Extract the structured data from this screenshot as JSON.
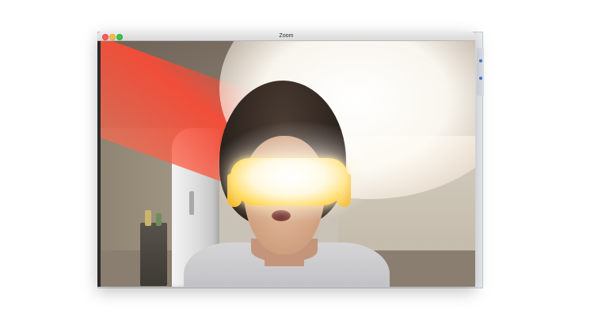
{
  "window": {
    "title": "Zoom"
  },
  "colors": {
    "close": "#fc605c",
    "minimize": "#fdbc40",
    "maximize": "#34c84a",
    "goggle_accent": "#f7b417",
    "red_light": "#f74c37"
  },
  "icons": [
    "close-button",
    "minimize-button",
    "maximize-button"
  ]
}
